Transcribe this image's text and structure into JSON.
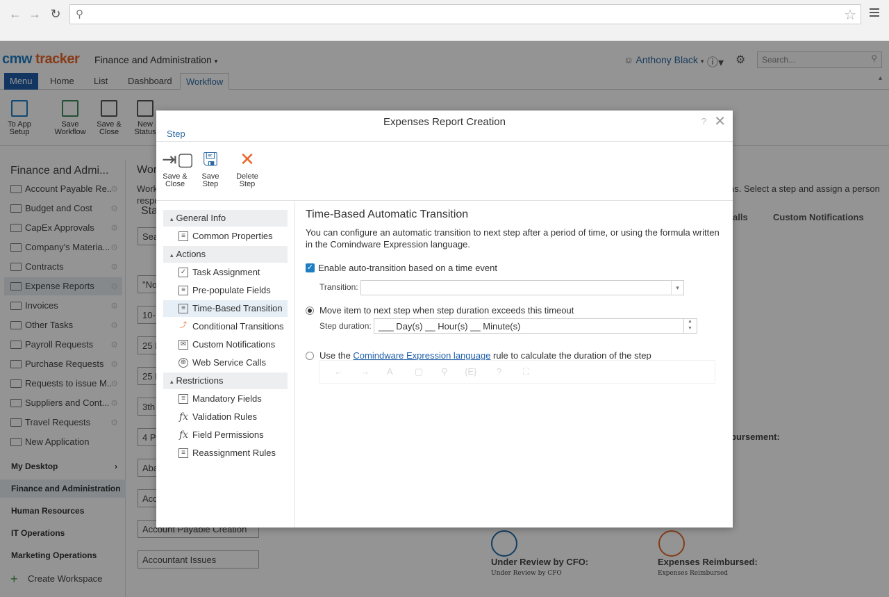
{
  "browser": {
    "search_icon": "search-icon",
    "star_icon": "star-icon"
  },
  "app": {
    "logo_cmw": "cmw",
    "logo_tracker": "tracker",
    "workspace": "Finance and Administration",
    "user": "Anthony Black",
    "search_placeholder": "Search..."
  },
  "tabs": [
    "Menu",
    "Home",
    "List",
    "Dashboard",
    "Workflow"
  ],
  "ribbon": [
    "To App Setup",
    "Save Workflow",
    "Save & Close",
    "New Status"
  ],
  "sidebar": {
    "title": "Finance and Admi...",
    "items": [
      "Account Payable Re..",
      "Budget and Cost",
      "CapEx Approvals",
      "Company's Materia...",
      "Contracts",
      "Expense Reports",
      "Invoices",
      "Other Tasks",
      "Payroll Requests",
      "Purchase Requests",
      "Requests to issue M..",
      "Suppliers and Cont...",
      "Travel Requests",
      "New Application"
    ],
    "sections": [
      "My Desktop",
      "Finance and Administration",
      "Human Resources",
      "IT Operations",
      "Marketing Operations"
    ],
    "create": "Create Workspace"
  },
  "background": {
    "title": "Wor",
    "desc_left1": "Work",
    "desc_left2": "respo",
    "sta": "Sta",
    "sea": "Sea",
    "right_desc": "ns. Select a step and assign a person",
    "tab_calls": "alls",
    "tab_custom": "Custom Notifications",
    "reimb": "bursement:",
    "boxes": [
      "\"No",
      "10-I",
      "25 D",
      "25 D",
      "3th",
      "4 Pa",
      "Aba",
      "Acc",
      "Account Payable Creation",
      "Accountant Issues"
    ],
    "node1_title": "Under Review by CFO:",
    "node1_sub": "Under Review by CFO",
    "node2_title": "Expenses Reimbursed:",
    "node2_sub": "Expenses Reimbursed"
  },
  "dialog": {
    "title": "Expenses Report Creation",
    "help": "?",
    "close": "✕",
    "breadcrumb": "Step",
    "toolbar": {
      "save_close_1": "Save &",
      "save_close_2": "Close",
      "save_step_1": "Save",
      "save_step_2": "Step",
      "delete_1": "Delete",
      "delete_2": "Step"
    },
    "groups": {
      "general": "General Info",
      "actions": "Actions",
      "restrictions": "Restrictions"
    },
    "items": {
      "common": "Common Properties",
      "task": "Task Assignment",
      "prepop": "Pre-populate Fields",
      "timebased": "Time-Based Transition",
      "conditional": "Conditional Transitions",
      "notifications": "Custom Notifications",
      "webservice": "Web Service Calls",
      "mandatory": "Mandatory Fields",
      "validation": "Validation Rules",
      "permissions": "Field Permissions",
      "reassign": "Reassignment Rules"
    },
    "content": {
      "title": "Time-Based Automatic Transition",
      "desc": "You can configure an automatic transition to next step after a period of time, or using the formula written in the Comindware Expression language.",
      "enable_label": "Enable auto-transition based on a time event",
      "enable_checked": true,
      "transition_label": "Transition:",
      "transition_value": "",
      "option1": "Move item to next step when step duration exceeds this timeout",
      "duration_label": "Step duration:",
      "duration_value": "___ Day(s)  __ Hour(s)  __ Minute(s)",
      "option2_pre": "Use the ",
      "option2_link": "Comindware Expression language",
      "option2_post": " rule to calculate the duration of the step"
    }
  }
}
